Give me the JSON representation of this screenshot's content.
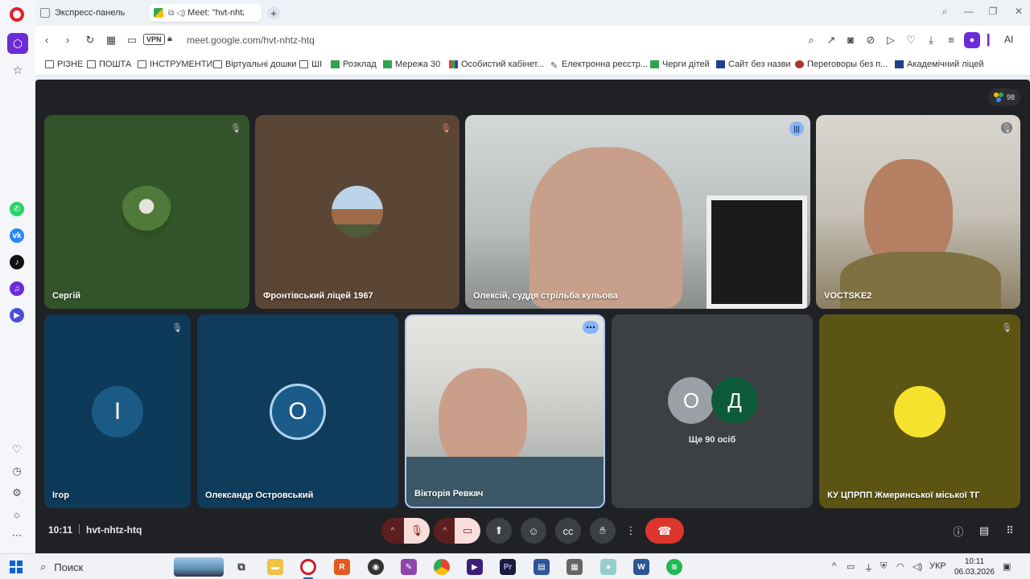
{
  "browser": {
    "tabs": [
      {
        "label": "Экспресс-панель",
        "active": false
      },
      {
        "label": "Meet: \"hvt-nhtz-ht",
        "active": true
      }
    ],
    "url": "meet.google.com/hvt-nhtz-htq",
    "vpn_label": "VPN",
    "ai_label": "AI",
    "bookmarks": [
      {
        "label": "РІЗНЕ",
        "icon": "folder-icon"
      },
      {
        "label": "ПОШТА",
        "icon": "folder-icon"
      },
      {
        "label": "ІНСТРУМЕНТИ",
        "icon": "folder-icon"
      },
      {
        "label": "Віртуальні дошки",
        "icon": "folder-icon"
      },
      {
        "label": "ШІ",
        "icon": "folder-icon"
      },
      {
        "label": "Розклад",
        "icon": "green-plus-icon"
      },
      {
        "label": "Мережа 30",
        "icon": "green-plus-icon"
      },
      {
        "label": "Особистий кабінет...",
        "icon": "multicolor-icon"
      },
      {
        "label": "Електронна реєстр...",
        "icon": "pen-icon"
      },
      {
        "label": "Черги дітей",
        "icon": "green-plus-icon"
      },
      {
        "label": "Сайт без назви",
        "icon": "blue-doc-icon"
      },
      {
        "label": "Переговоры без п...",
        "icon": "red-circle-icon"
      },
      {
        "label": "Академічний ліцей",
        "icon": "blue-doc-icon"
      }
    ]
  },
  "meet": {
    "participant_count": "98",
    "tiles": [
      {
        "name": "Сергій",
        "muted": true
      },
      {
        "name": "Фронтівський ліцей 1967",
        "muted": true
      },
      {
        "name": "Олексій, суддя стрільба кульова",
        "speaking": true
      },
      {
        "name": "VOCTSKE2",
        "muted": true
      },
      {
        "name": "Ігор",
        "letter": "І",
        "muted": true
      },
      {
        "name": "Олександр Островський",
        "letter": "О"
      },
      {
        "name": "Вікторія Ревкач"
      },
      {
        "name": "",
        "letters": [
          "О",
          "Д"
        ],
        "others_label": "Ще 90 осіб"
      },
      {
        "name": "КУ ЦПРПП Жмеринської міської ТГ",
        "muted": true
      }
    ],
    "time": "10:11",
    "meeting_code": "hvt-nhtz-htq",
    "colors": {
      "bg": "#202124",
      "end_call": "#dc362e",
      "mic_off": "#f9dedc"
    }
  },
  "taskbar": {
    "search_placeholder": "Поиск",
    "lang": "УКР",
    "time": "10:11",
    "date": "06.03.2026"
  }
}
